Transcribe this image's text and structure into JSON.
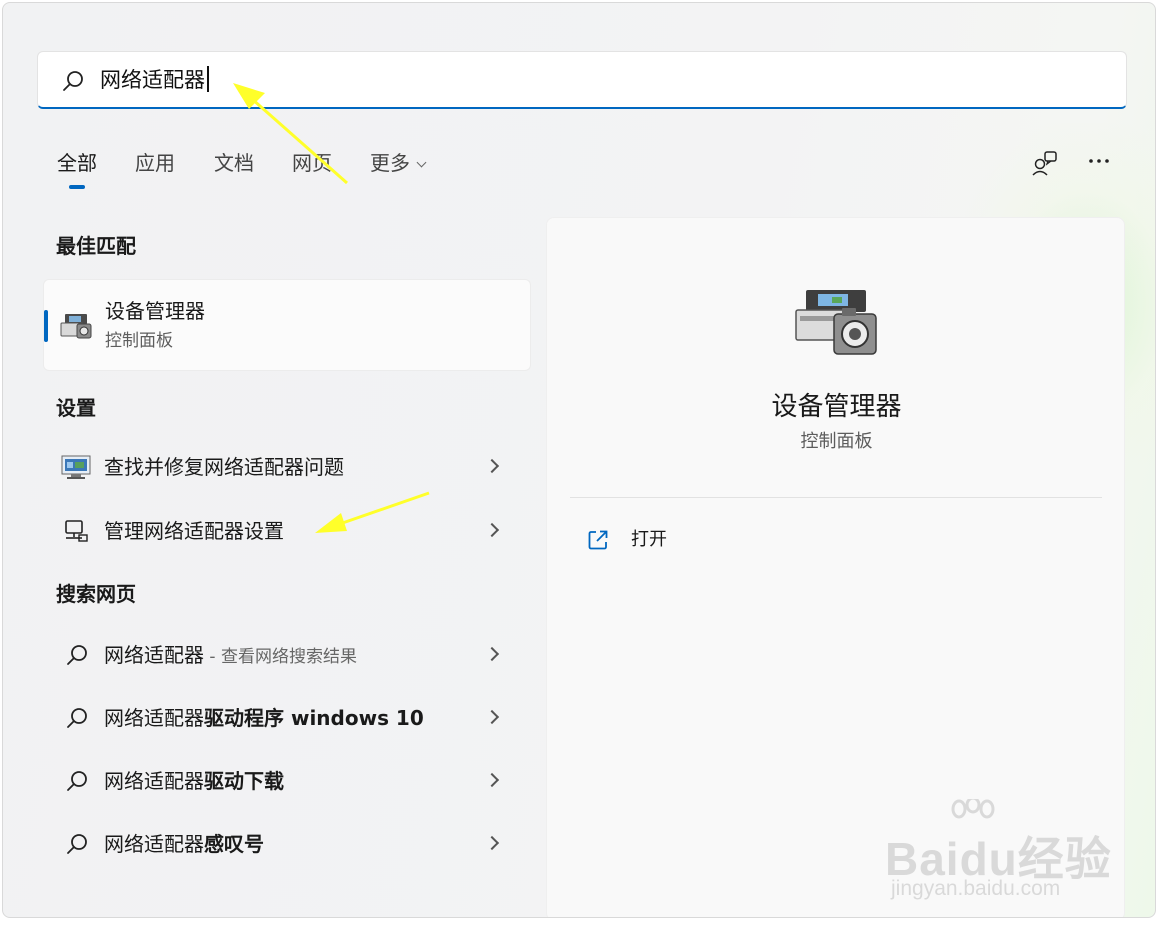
{
  "search": {
    "query": "网络适配器"
  },
  "tabs": [
    {
      "label": "全部"
    },
    {
      "label": "应用"
    },
    {
      "label": "文档"
    },
    {
      "label": "网页"
    },
    {
      "label": "更多"
    }
  ],
  "sections": {
    "best_match": "最佳匹配",
    "settings": "设置",
    "web": "搜索网页"
  },
  "best_match": {
    "title": "设备管理器",
    "subtitle": "控制面板",
    "icon": "device-manager-icon"
  },
  "settings_items": [
    {
      "label": "查找并修复网络适配器问题",
      "icon": "network-troubleshoot-icon"
    },
    {
      "label": "管理网络适配器设置",
      "icon": "network-adapter-icon"
    }
  ],
  "web_items": [
    {
      "query": "网络适配器",
      "suffix": " - 查看网络搜索结果"
    },
    {
      "query": "网络适配器",
      "bold": "驱动程序 windows 10"
    },
    {
      "query": "网络适配器",
      "bold": "驱动下载"
    },
    {
      "query": "网络适配器",
      "bold": "感叹号"
    }
  ],
  "preview": {
    "title": "设备管理器",
    "subtitle": "控制面板",
    "open_label": "打开",
    "icon": "device-manager-icon"
  },
  "watermark": {
    "brand": "Baidu经验",
    "url": "jingyan.baidu.com"
  },
  "colors": {
    "accent": "#0067c0",
    "annotation_arrow": "#ffff2a"
  }
}
